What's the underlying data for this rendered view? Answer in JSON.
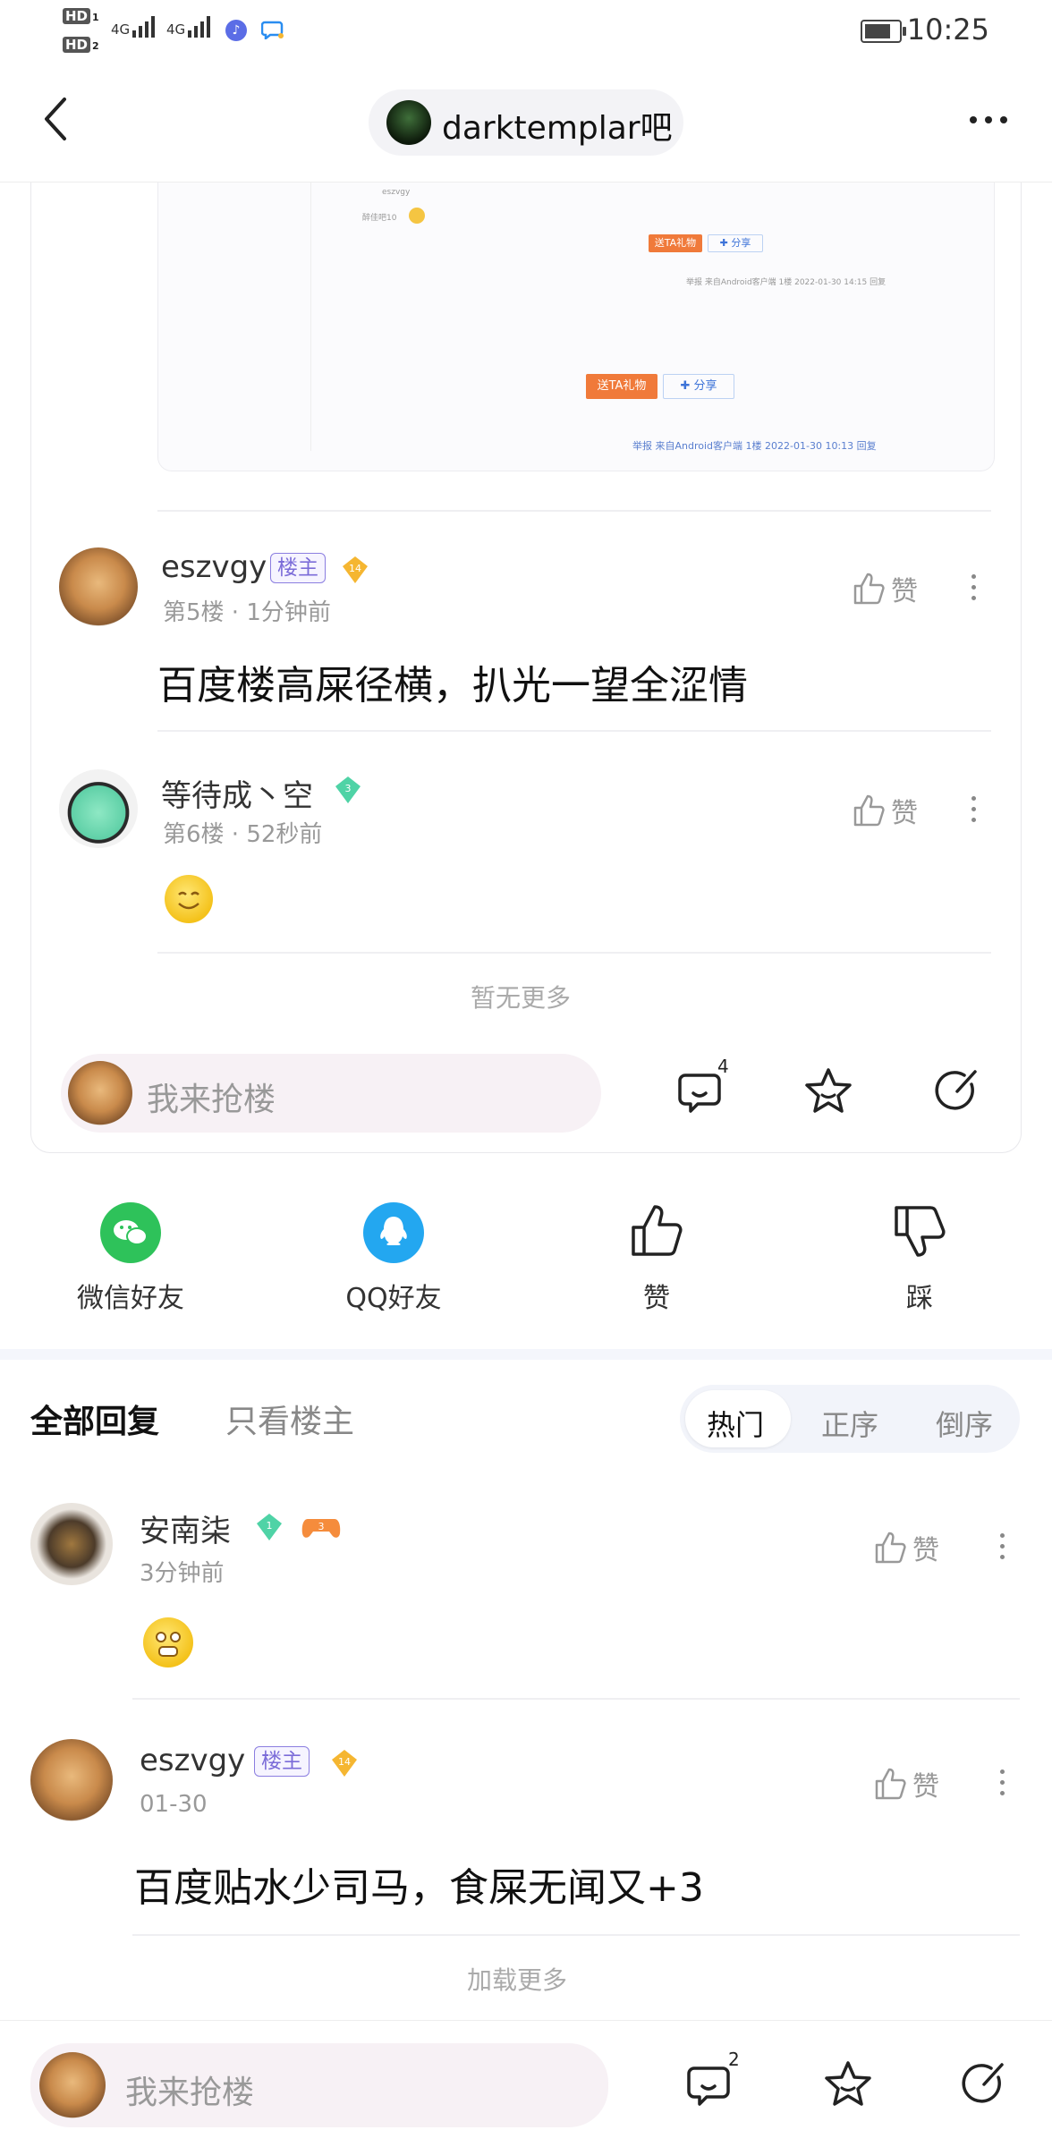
{
  "status_bar": {
    "hd1": "HD",
    "hd1_sub": "1",
    "hd2": "HD",
    "hd2_sub": "2",
    "net1": "4G",
    "net2": "4G",
    "time": "10:25"
  },
  "header": {
    "forum_name": "darktemplar吧"
  },
  "embedded_screenshot": {
    "name": "eszvgy",
    "level_label": "醉佳吧10",
    "gift_label": "送TA礼物",
    "share_label": "分享",
    "meta1": "举报  来自Android客户端  1楼  2022-01-30 14:15  回复",
    "meta2": "举报  来自Android客户端  1楼  2022-01-30 10:13  回复"
  },
  "floors": [
    {
      "user": "eszvgy",
      "host_badge": "楼主",
      "level": "14",
      "meta": "第5楼 · 1分钟前",
      "content": "百度楼高屎径横，扒光一望全涩情",
      "like": "赞"
    },
    {
      "user": "等待成丶空",
      "level": "3",
      "meta": "第6楼 · 52秒前",
      "like": "赞"
    }
  ],
  "no_more": "暂无更多",
  "card_input": {
    "placeholder": "我来抢楼",
    "comment_count": "4"
  },
  "share_row": [
    {
      "label": "微信好友",
      "icon": "wechat-icon"
    },
    {
      "label": "QQ好友",
      "icon": "qq-icon"
    },
    {
      "label": "赞",
      "icon": "thumb-up-icon"
    },
    {
      "label": "踩",
      "icon": "thumb-down-icon"
    }
  ],
  "reply_tabs": {
    "all": "全部回复",
    "host_only": "只看楼主"
  },
  "sort": {
    "hot": "热门",
    "asc": "正序",
    "desc": "倒序",
    "selected": "热门"
  },
  "replies": [
    {
      "user": "安南柒",
      "level": "1",
      "game_level": "3",
      "meta": "3分钟前",
      "like": "赞"
    },
    {
      "user": "eszvgy",
      "host_badge": "楼主",
      "level": "14",
      "meta": "01-30",
      "content": "百度贴水少司马，食屎无闻又+3",
      "like": "赞"
    }
  ],
  "load_more": "加载更多",
  "bottom_bar": {
    "placeholder": "我来抢楼",
    "comment_count": "2"
  },
  "colors": {
    "host_badge": "#7b6cd8",
    "wechat": "#2ec25a",
    "qq": "#23a7f0",
    "orange": "#f07a3a",
    "level_gold": "#f5b631",
    "level_green": "#4fd3a6"
  }
}
